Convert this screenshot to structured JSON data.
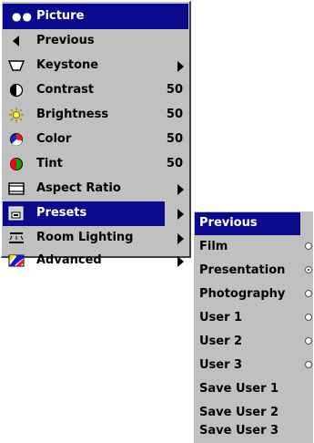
{
  "menu": {
    "title": "Picture",
    "items": [
      {
        "icon": "back-arrow-icon",
        "label": "Previous",
        "value": "",
        "arrow": false
      },
      {
        "icon": "keystone-icon",
        "label": "Keystone",
        "value": "",
        "arrow": true
      },
      {
        "icon": "contrast-icon",
        "label": "Contrast",
        "value": "50",
        "arrow": false
      },
      {
        "icon": "brightness-sun-icon",
        "label": "Brightness",
        "value": "50",
        "arrow": false
      },
      {
        "icon": "color-icon",
        "label": "Color",
        "value": "50",
        "arrow": false
      },
      {
        "icon": "tint-icon",
        "label": "Tint",
        "value": "50",
        "arrow": false
      },
      {
        "icon": "aspect-ratio-icon",
        "label": "Aspect Ratio",
        "value": "",
        "arrow": true
      },
      {
        "icon": "presets-icon",
        "label": "Presets",
        "value": "",
        "arrow": true,
        "selected": true
      },
      {
        "icon": "room-lighting-icon",
        "label": "Room Lighting",
        "value": "",
        "arrow": true
      },
      {
        "icon": "advanced-icon",
        "label": "Advanced",
        "value": "",
        "arrow": true
      }
    ]
  },
  "submenu": {
    "items": [
      {
        "label": "Previous",
        "radio": null,
        "selected": true
      },
      {
        "label": "Film",
        "radio": false
      },
      {
        "label": "Presentation",
        "radio": true
      },
      {
        "label": "Photography",
        "radio": false
      },
      {
        "label": "User 1",
        "radio": false
      },
      {
        "label": "User 2",
        "radio": false
      },
      {
        "label": "User 3",
        "radio": false
      },
      {
        "label": "Save User 1",
        "radio": null
      },
      {
        "label": "Save User 2",
        "radio": null
      },
      {
        "label": "Save User 3",
        "radio": null
      }
    ]
  },
  "colors": {
    "menu_bg": "#c0c0c0",
    "highlight": "#0a0a8c"
  }
}
